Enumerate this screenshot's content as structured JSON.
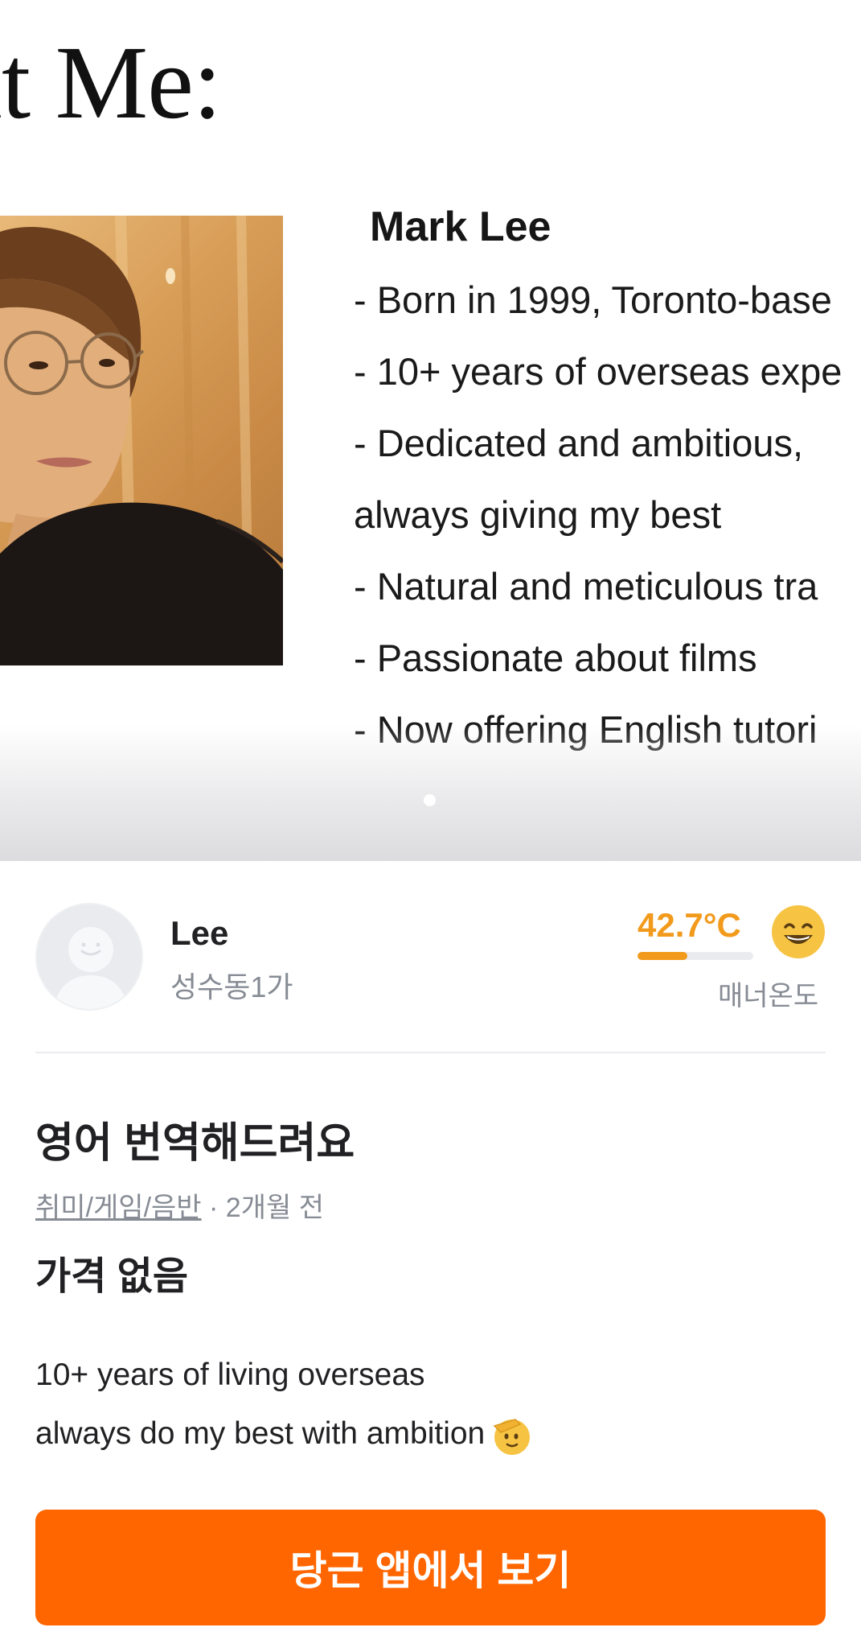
{
  "hero": {
    "title": "ut Me:",
    "name_heading": "Mark Lee",
    "bio_lines": [
      "-  Born in 1999, Toronto-base",
      "-  10+ years of overseas expe",
      "-  Dedicated and ambitious,",
      "always giving my best",
      "-  Natural and meticulous tra",
      "-  Passionate about films",
      "-  Now offering English tutori"
    ],
    "page_indicator": {
      "current": 1,
      "total": 1
    }
  },
  "seller": {
    "name": "Lee",
    "location": "성수동1가",
    "manner_temperature": "42.7°C",
    "manner_temperature_value": 42.7,
    "manner_label": "매너온도",
    "emoji_icon": "grinning-face-icon"
  },
  "listing": {
    "title": "영어 번역해드려요",
    "category": "취미/게임/음반",
    "separator": " · ",
    "posted": "2개월 전",
    "price": "가격 없음",
    "description_lines": [
      "10+ years of living overseas",
      "always do my best with ambition"
    ],
    "description_emoji_icon": "saluting-face-icon"
  },
  "cta": {
    "label": "당근 앱에서 보기"
  },
  "colors": {
    "accent": "#ff6600",
    "temperature": "#f29a1c",
    "muted_text": "#868b94",
    "text": "#212124"
  }
}
